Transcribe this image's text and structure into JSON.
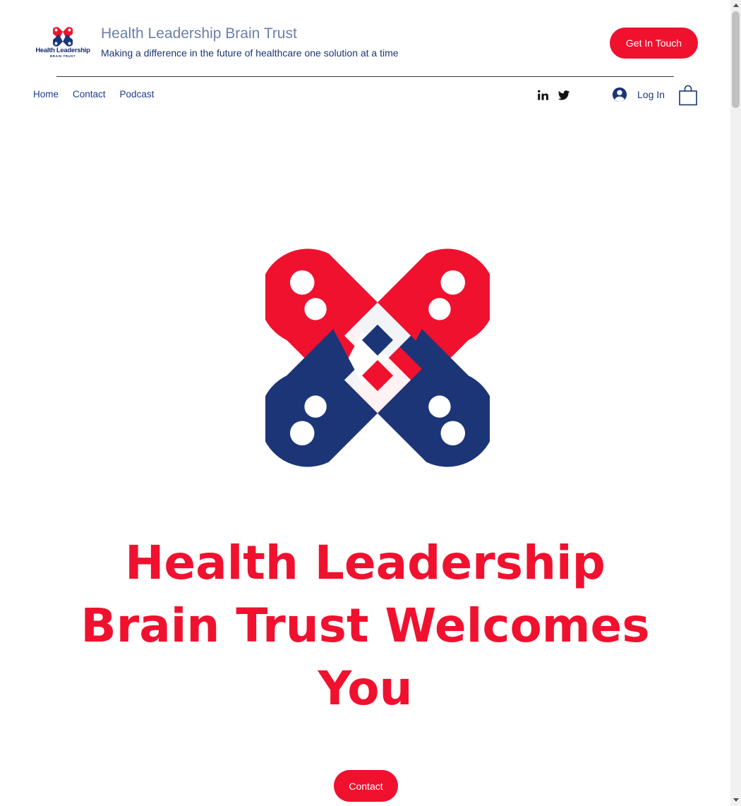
{
  "header": {
    "logo_line1": "Health Leadership",
    "logo_line2": "BRAIN TRUST",
    "site_title": "Health Leadership Brain Trust",
    "tagline": "Making a difference in the future of healthcare one solution at a time",
    "cta_label": "Get In Touch"
  },
  "nav": {
    "items": [
      {
        "label": "Home"
      },
      {
        "label": "Contact"
      },
      {
        "label": "Podcast"
      }
    ]
  },
  "social": {
    "icons": [
      "linkedin-icon",
      "twitter-icon"
    ]
  },
  "account": {
    "login_label": "Log In"
  },
  "hero": {
    "heading": "Health Leadership Brain Trust Welcomes You",
    "button_label": "Contact"
  },
  "colors": {
    "brand_red": "#f0112f",
    "brand_navy": "#1b3577",
    "text_blue": "#1c3573"
  }
}
